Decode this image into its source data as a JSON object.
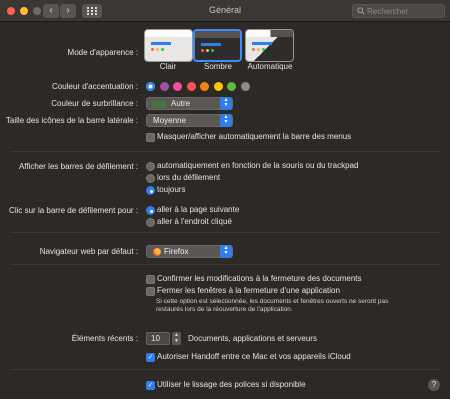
{
  "window": {
    "title": "Général"
  },
  "search": {
    "placeholder": "Rechercher"
  },
  "appearance": {
    "label": "Mode d'apparence :",
    "options": [
      "Clair",
      "Sombre",
      "Automatique"
    ],
    "selected": "Sombre"
  },
  "accent": {
    "label": "Couleur d'accentuation :",
    "colors": [
      "#2f7ef0",
      "#a550a7",
      "#f74f9e",
      "#ff5257",
      "#f7821b",
      "#ffc600",
      "#62ba46",
      "#8c8c8c"
    ],
    "selected_index": 0
  },
  "highlight": {
    "label": "Couleur de surbrillance :",
    "value": "Autre",
    "swatch_color": "#3f7a38"
  },
  "sidebar_icon_size": {
    "label": "Taille des icônes de la barre latérale :",
    "value": "Moyenne"
  },
  "menubar": {
    "label": "Masquer/afficher automatiquement la barre des menus",
    "checked": false
  },
  "show_scrollbars": {
    "label": "Afficher les barres de défilement :",
    "options": [
      "automatiquement en fonction de la souris ou du trackpad",
      "lors du défilement",
      "toujours"
    ],
    "selected_index": 2
  },
  "click_scrollbar": {
    "label": "Clic sur la barre de défilement pour :",
    "options": [
      "aller à la page suivante",
      "aller à l'endroit cliqué"
    ],
    "selected_index": 0
  },
  "browser": {
    "label": "Navigateur web par défaut :",
    "value": "Firefox"
  },
  "confirm_changes": {
    "label": "Confirmer les modifications à la fermeture des documents",
    "checked": false
  },
  "close_windows": {
    "label": "Fermer les fenêtres à la fermeture d'une application",
    "checked": false,
    "note": "Si cette option est sélectionnée, les documents et fenêtres ouverts ne seront pas restaurés lors de la réouverture de l'application."
  },
  "recent_items": {
    "label": "Éléments récents :",
    "value": "10",
    "suffix": "Documents, applications et serveurs"
  },
  "handoff": {
    "label": "Autoriser Handoff entre ce Mac et vos appareils iCloud",
    "checked": true
  },
  "font_smoothing": {
    "label": "Utiliser le lissage des polices si disponible",
    "checked": true
  },
  "help": {
    "symbol": "?"
  }
}
